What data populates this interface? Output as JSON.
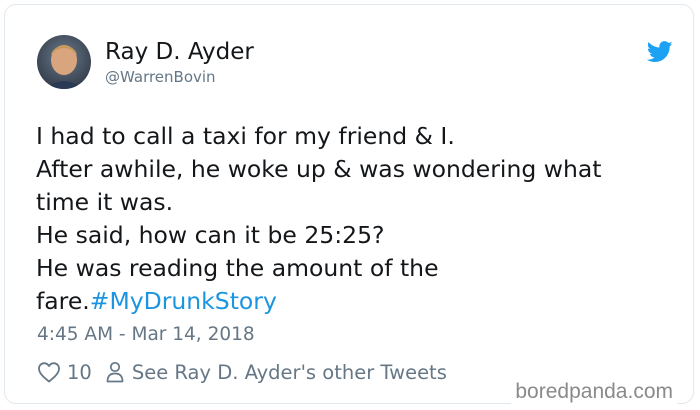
{
  "user": {
    "display_name": "Ray D. Ayder",
    "handle": "@WarrenBovin"
  },
  "tweet": {
    "lines": [
      "I had to call a taxi for my friend & I.",
      "After awhile, he woke up & was wondering what",
      "time it was.",
      "He said, how can it be 25:25?",
      "He was reading the amount of the",
      "fare."
    ],
    "hashtag": "#MyDrunkStory",
    "timestamp": "4:45 AM - Mar 14, 2018"
  },
  "actions": {
    "like_count": "10",
    "other_tweets_label": "See Ray D. Ayder's other Tweets"
  },
  "watermark": "boredpanda.com",
  "icons": {
    "brand": "twitter-bird-icon",
    "like": "heart-icon",
    "profile": "person-icon"
  },
  "colors": {
    "twitter_blue": "#1da1f2",
    "hashtag": "#1b95e0",
    "text": "#14171a",
    "secondary": "#657786"
  }
}
